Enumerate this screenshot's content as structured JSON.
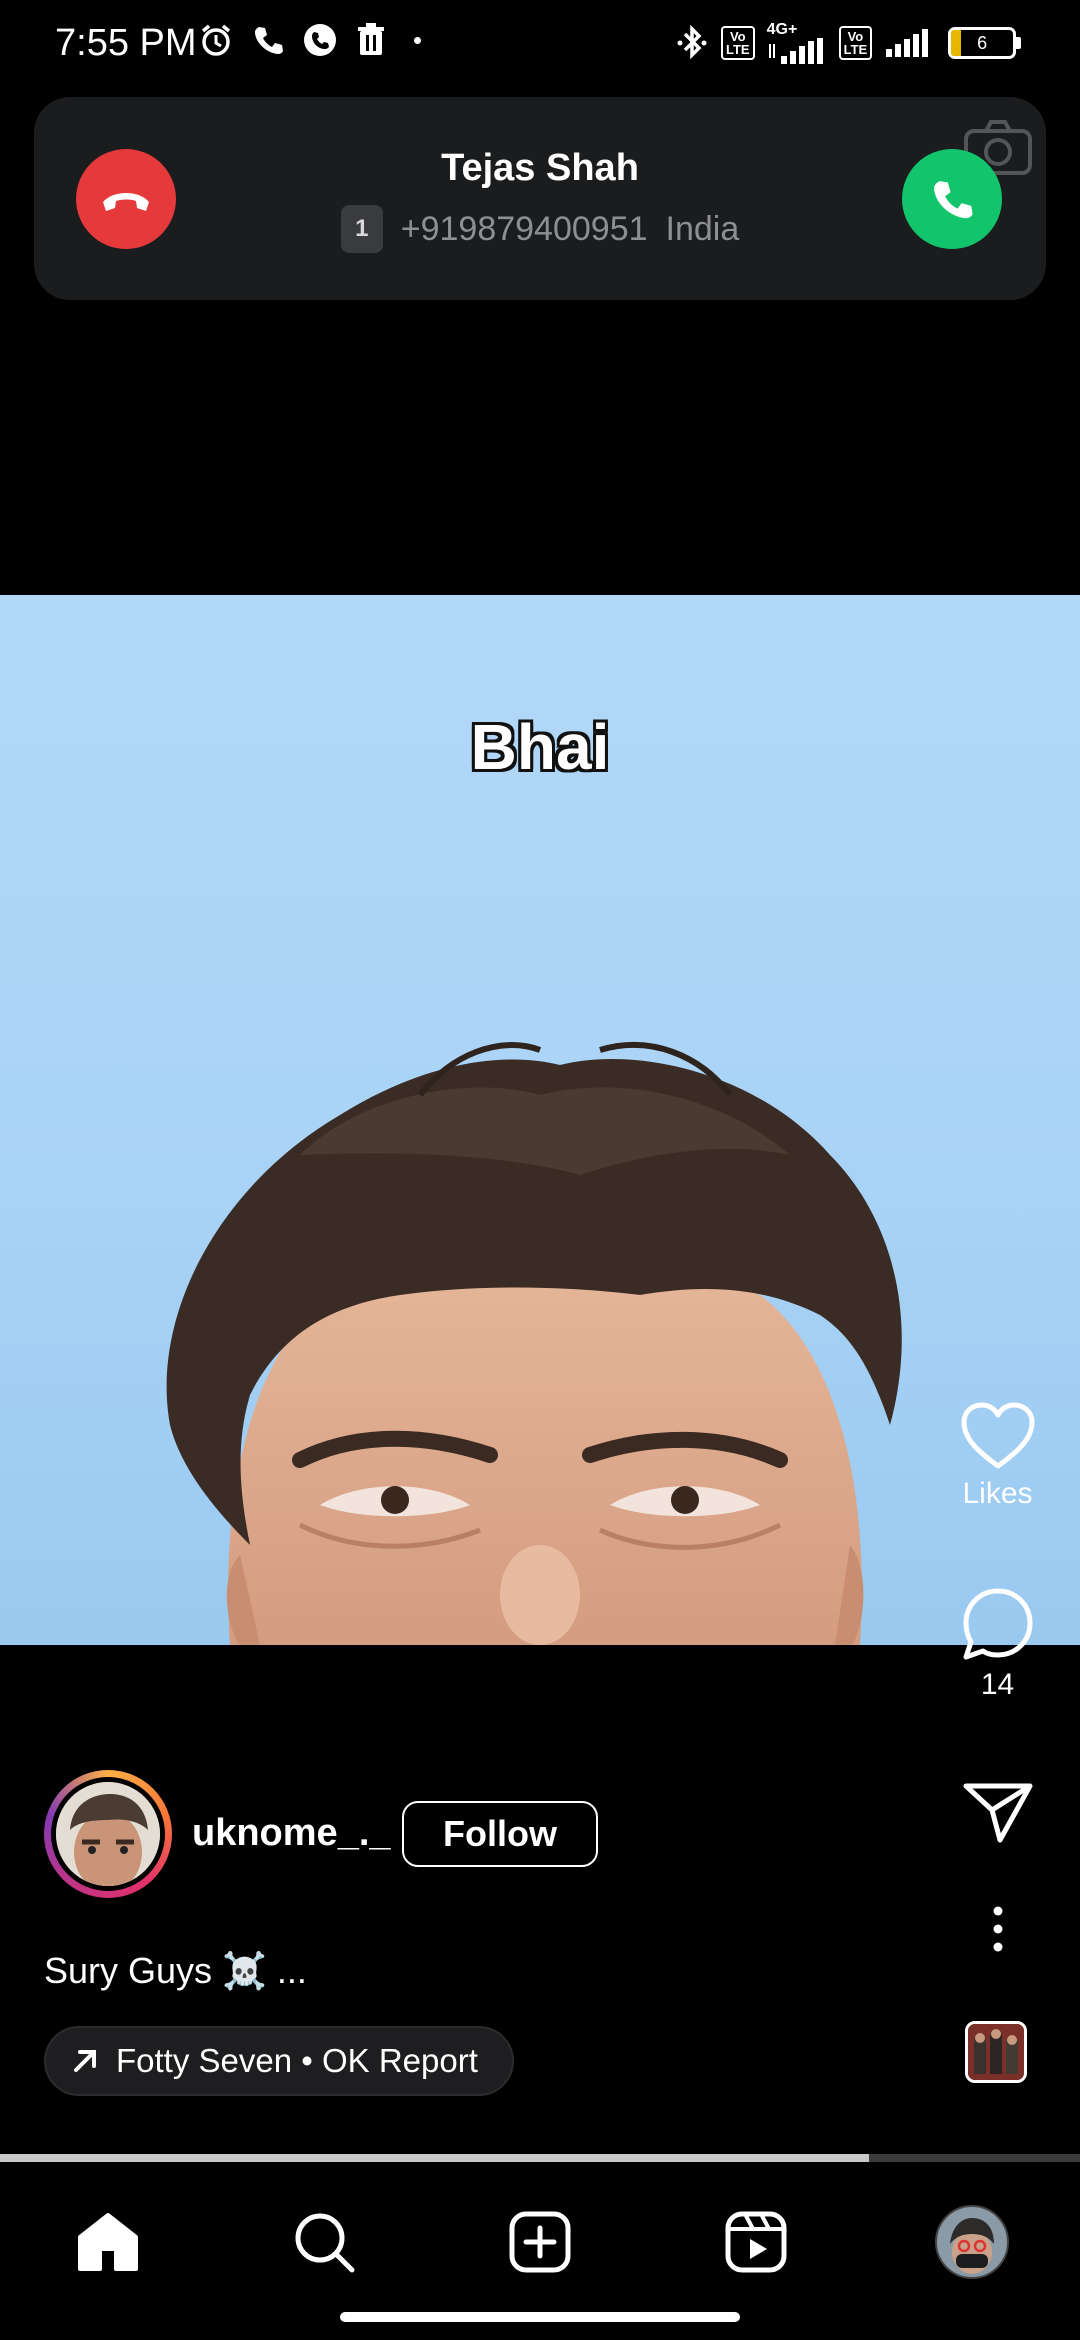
{
  "status_bar": {
    "time": "7:55 PM",
    "network_label": "4G+",
    "volte_label": "Vo\nLTE",
    "battery_level": "6"
  },
  "incoming_call": {
    "caller_name": "Tejas Shah",
    "sim_slot": "1",
    "phone_number": "+919879400951",
    "location": "India",
    "decline_color": "#e5393b",
    "accept_color": "#12c46b"
  },
  "reel": {
    "overlay_text": "Bhai",
    "likes_label": "Likes",
    "comment_count": "14",
    "progress": 0.805
  },
  "author": {
    "username": "uknome_._",
    "follow_label": "Follow",
    "caption": "Sury Guys ☠️ ..."
  },
  "audio": {
    "track": "Fotty Seven • OK Report"
  },
  "bottom_nav": {
    "items": [
      "home-icon",
      "search-icon",
      "create-icon",
      "reels-icon",
      "profile-avatar"
    ]
  }
}
